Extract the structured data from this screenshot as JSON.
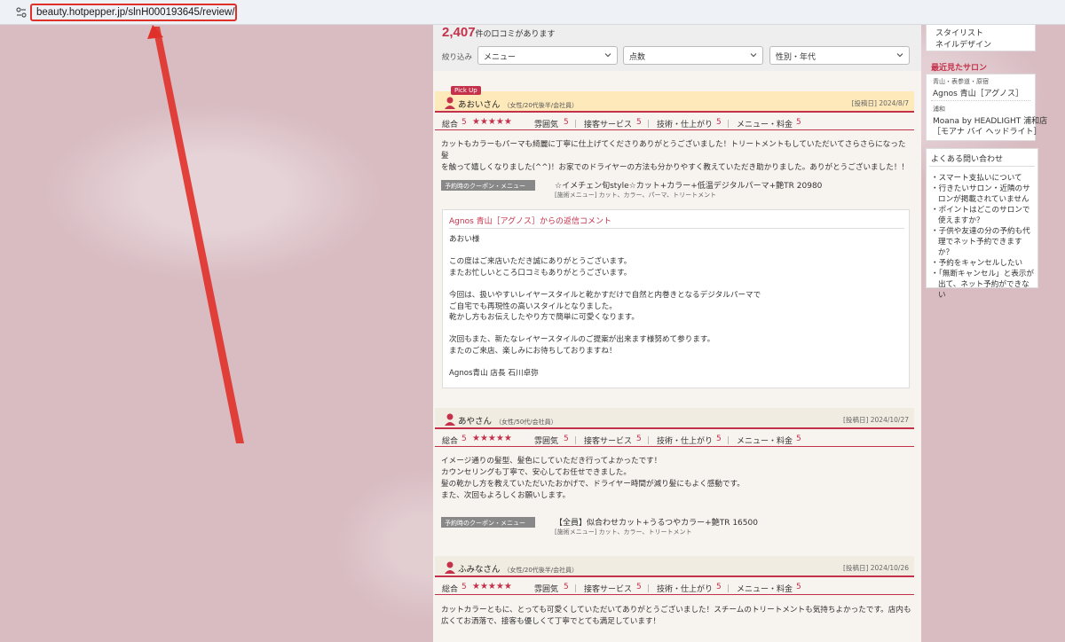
{
  "browser": {
    "url": "beauty.hotpepper.jp/slnH000193645/review/"
  },
  "summary": {
    "count_number": "2,407",
    "count_suffix": "件の口コミがあります",
    "filter_label": "絞り込み",
    "filters": [
      "メニュー",
      "点数",
      "性別・年代"
    ]
  },
  "rating_labels": {
    "overall": "総合",
    "atmosphere": "雰囲気",
    "service": "接客サービス",
    "technique": "技術・仕上がり",
    "price": "メニュー・料金",
    "stars": "★★★★★",
    "coupon_tag": "予約時のクーポン・メニュー",
    "sep": "｜"
  },
  "reviews": [
    {
      "pickup": "Pick Up",
      "name": "あおいさん",
      "meta": "（女性/20代後半/会社員）",
      "date": "[投稿日] 2024/8/7",
      "overall": "5",
      "atmosphere": "5",
      "service": "5",
      "technique": "5",
      "price": "5",
      "body": [
        "カットもカラーもパーマも綺麗に丁寧に仕上げてくださりありがとうございました！トリートメントもしていただいてさらさらになった髪",
        "を触って嬉しくなりました(^^)！お家でのドライヤーの方法も分かりやすく教えていただき助かりました。ありがとうございました！！"
      ],
      "coupon_name": "☆イメチェン旬style☆カット+カラー+低温デジタルパーマ+艶TR 20980",
      "coupon_menu": "[施術メニュー] カット、カラー、パーマ、トリートメント",
      "reply_title": "Agnos 青山［アグノス］からの返信コメント",
      "reply_text": "あおい様\n\nこの度はご来店いただき誠にありがとうございます。\nまたお忙しいところ口コミもありがとうございます。\n\n今回は、扱いやすいレイヤースタイルと乾かすだけで自然と内巻きとなるデジタルパーマで\nご自宅でも再現性の高いスタイルとなりました。\n乾かし方もお伝えしたやり方で簡単に可愛くなります。\n\n次回もまた、新たなレイヤースタイルのご提案が出来ます様努めて参ります。\nまたのご来店、楽しみにお待ちしておりますね！\n\nAgnos青山 店長 石川卓弥"
    },
    {
      "name": "あやさん",
      "meta": "（女性/50代/会社員）",
      "date": "[投稿日] 2024/10/27",
      "overall": "5",
      "atmosphere": "5",
      "service": "5",
      "technique": "5",
      "price": "5",
      "body": [
        "イメージ通りの髪型、髪色にしていただき行ってよかったです！",
        "カウンセリングも丁寧で、安心してお任せできました。",
        "髪の乾かし方を教えていただいたおかげで、ドライヤー時間が減り髪にもよく感動です。",
        "また、次回もよろしくお願いします。"
      ],
      "coupon_name": "【全員】似合わせカット+うるつやカラー+艶TR 16500",
      "coupon_menu": "[施術メニュー] カット、カラー、トリートメント"
    },
    {
      "name": "ふみなさん",
      "meta": "（女性/20代後半/会社員）",
      "date": "[投稿日] 2024/10/26",
      "overall": "5",
      "atmosphere": "5",
      "service": "5",
      "technique": "5",
      "price": "5",
      "body": [
        "カットカラーともに、とっても可愛くしていただいてありがとうございました！スチームのトリートメントも気持ちよかったです。店内も",
        "広くてお洒落で、接客も優しくて丁寧でとても満足しています！"
      ]
    }
  ],
  "sidebar": {
    "links": [
      "スタイリスト",
      "ネイルデザイン"
    ],
    "recent_title": "最近見たサロン",
    "recent": [
      {
        "area": "青山・表参道・原宿",
        "name": "Agnos 青山［アグノス］"
      },
      {
        "area": "浦和",
        "name": "Moana by HEADLIGHT 浦和店",
        "name2": "［モアナ バイ ヘッドライト］"
      }
    ],
    "faq_title": "よくある問い合わせ",
    "faq": [
      "スマート支払いについて",
      "行きたいサロン・近隣のサロンが掲載されていません",
      "ポイントはどこのサロンで使えますか？",
      "子供や友達の分の予約も代理でネット予約できますか？",
      "予約をキャンセルしたい",
      "「無断キャンセル」と表示が出て、ネット予約ができない"
    ]
  },
  "colors": {
    "accent": "#c4314b",
    "annotation": "#e0302a"
  }
}
